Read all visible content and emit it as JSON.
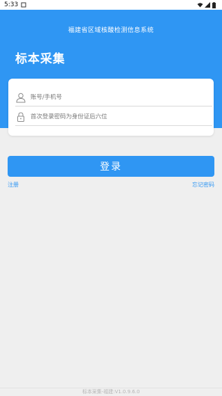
{
  "status_bar": {
    "time": "5:33",
    "notification_icon": "square-notification-icon",
    "wifi_icon": "wifi-icon",
    "signal_icon": "signal-icon",
    "battery_icon": "battery-icon"
  },
  "header": {
    "app_title": "福建省区域核酸检测信息系统",
    "page_heading": "标本采集",
    "background_color": "#2f96f3"
  },
  "form": {
    "account": {
      "icon": "user-icon",
      "value": "",
      "placeholder": "账号/手机号"
    },
    "password": {
      "icon": "lock-icon",
      "value": "",
      "placeholder": "首次登录密码为身份证后六位"
    }
  },
  "actions": {
    "login_label": "登录",
    "register_label": "注册",
    "forgot_password_label": "忘记密码"
  },
  "footer": {
    "version_text": "标本采集-福建:V1.0.9.6.0"
  }
}
